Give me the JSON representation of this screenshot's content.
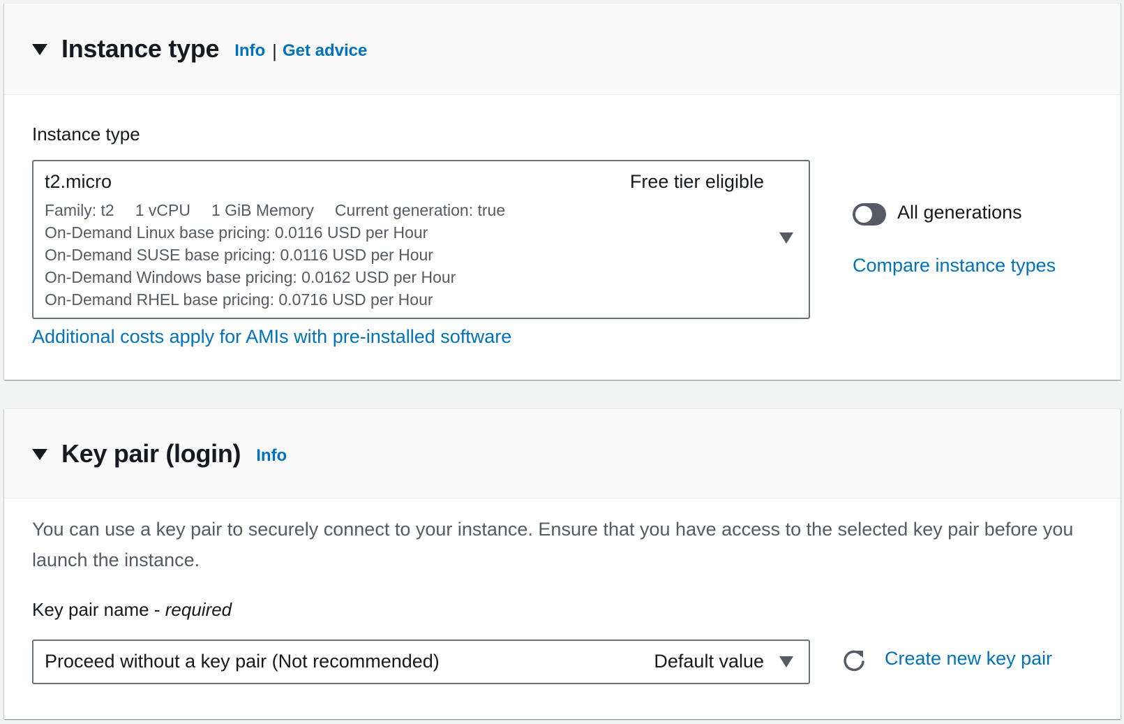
{
  "instance_type_section": {
    "title": "Instance type",
    "info_link": "Info",
    "separator": "|",
    "advice_link": "Get advice",
    "field_label": "Instance type",
    "selected": {
      "name": "t2.micro",
      "badge": "Free tier eligible",
      "specs": [
        "Family: t2",
        "1 vCPU",
        "1 GiB Memory",
        "Current generation: true"
      ],
      "pricing": [
        "On-Demand Linux base pricing: 0.0116 USD per Hour",
        "On-Demand SUSE base pricing: 0.0116 USD per Hour",
        "On-Demand Windows base pricing: 0.0162 USD per Hour",
        "On-Demand RHEL base pricing: 0.0716 USD per Hour"
      ]
    },
    "toggle": {
      "label": "All generations",
      "checked": false
    },
    "compare_link": "Compare instance types",
    "additional_costs_link": "Additional costs apply for AMIs with pre-installed software"
  },
  "key_pair_section": {
    "title": "Key pair (login)",
    "info_link": "Info",
    "description": "You can use a key pair to securely connect to your instance. Ensure that you have access to the selected key pair before you launch the instance.",
    "field_label": "Key pair name - ",
    "field_label_required": "required",
    "selected_value": "Proceed without a key pair (Not recommended)",
    "selected_tag": "Default value",
    "create_link": "Create new key pair"
  },
  "colors": {
    "link": "#0073bb",
    "text": "#16191f",
    "secondary_text": "#545b64",
    "border": "#687078",
    "header_bg": "#fafafa",
    "page_bg": "#f2f3f3"
  }
}
